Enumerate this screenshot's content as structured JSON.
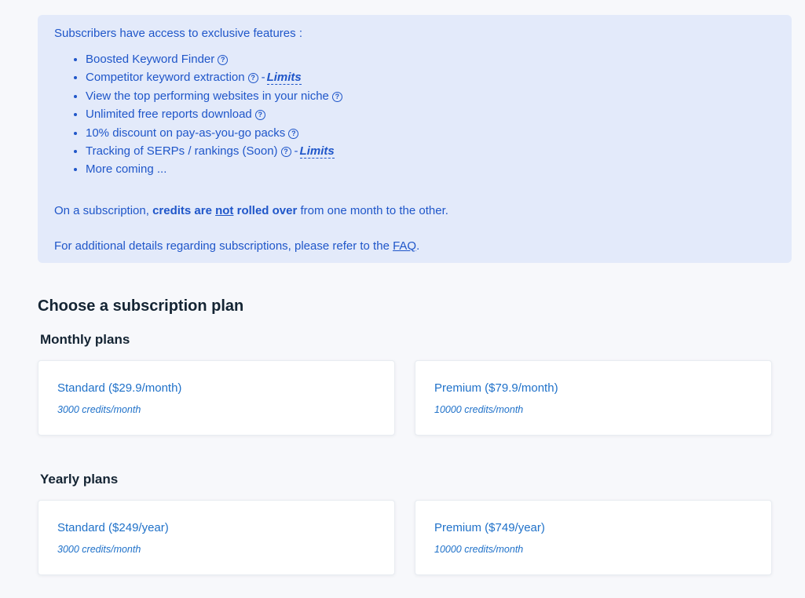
{
  "info": {
    "intro": "Subscribers have access to exclusive features :",
    "features": [
      {
        "label": "Boosted Keyword Finder",
        "limits": ""
      },
      {
        "label": "Competitor keyword extraction",
        "limits": "Limits"
      },
      {
        "label": "View the top performing websites in your niche",
        "limits": ""
      },
      {
        "label": "Unlimited free reports download",
        "limits": ""
      },
      {
        "label": "10% discount on pay-as-you-go packs",
        "limits": ""
      },
      {
        "label": "Tracking of SERPs / rankings (Soon)",
        "limits": "Limits"
      },
      {
        "label": "More coming ...",
        "limits": ""
      }
    ],
    "help_icon_glyph": "?",
    "separator": "-",
    "rollover": {
      "prefix": "On a subscription, ",
      "bold_a": "credits are ",
      "bold_underlined": "not",
      "bold_b": " rolled over",
      "suffix": " from one month to the other."
    },
    "faq": {
      "prefix": "For additional details regarding subscriptions, please refer to the ",
      "link": "FAQ",
      "suffix": "."
    }
  },
  "plans": {
    "title": "Choose a subscription plan",
    "monthly": {
      "title": "Monthly plans",
      "standard": {
        "name": "Standard ($29.9/month)",
        "credits": "3000 credits/month"
      },
      "premium": {
        "name": "Premium ($79.9/month)",
        "credits": "10000 credits/month"
      }
    },
    "yearly": {
      "title": "Yearly plans",
      "standard": {
        "name": "Standard ($249/year)",
        "credits": "3000 credits/month"
      },
      "premium": {
        "name": "Premium ($749/year)",
        "credits": "10000 credits/month"
      }
    }
  },
  "colors": {
    "info_background": "#e3eafa",
    "info_text": "#1f56c9",
    "plan_text": "#1f71c9",
    "heading_text": "#142433"
  }
}
